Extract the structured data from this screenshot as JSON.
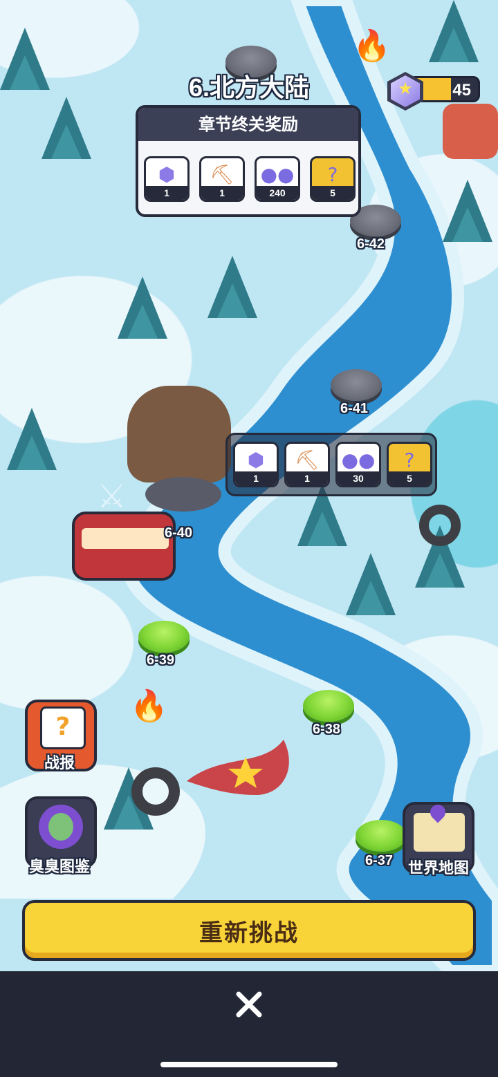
{
  "chapter_title": "6.北方大陆",
  "currency": {
    "value": "45",
    "icon": "star-gem-icon"
  },
  "chapter_rewards": {
    "header": "章节终关奖励",
    "items": [
      {
        "icon": "star-gem-icon",
        "count": "1"
      },
      {
        "icon": "shovel-icon",
        "count": "1"
      },
      {
        "icon": "purple-orbs-icon",
        "count": "240"
      },
      {
        "icon": "mystery-box-icon",
        "count": "5"
      }
    ]
  },
  "stage_rewards": {
    "items": [
      {
        "icon": "star-gem-icon",
        "count": "1"
      },
      {
        "icon": "shovel-icon",
        "count": "1"
      },
      {
        "icon": "purple-orbs-icon",
        "count": "30"
      },
      {
        "icon": "mystery-box-icon",
        "count": "5"
      }
    ]
  },
  "stages": [
    {
      "id": "6-42",
      "state": "locked"
    },
    {
      "id": "6-41",
      "state": "locked"
    },
    {
      "id": "6-40",
      "state": "current"
    },
    {
      "id": "6-39",
      "state": "cleared"
    },
    {
      "id": "6-38",
      "state": "cleared"
    },
    {
      "id": "6-37",
      "state": "cleared"
    }
  ],
  "side_buttons": {
    "battle_report": "战报",
    "zombie_codex": "臭臭图鉴",
    "world_map": "世界地图"
  },
  "challenge_button": "重新挑战",
  "colors": {
    "accent": "#f9d438",
    "cleared": "#7fd535",
    "locked": "#6b6e79",
    "dark": "#262a3a"
  }
}
